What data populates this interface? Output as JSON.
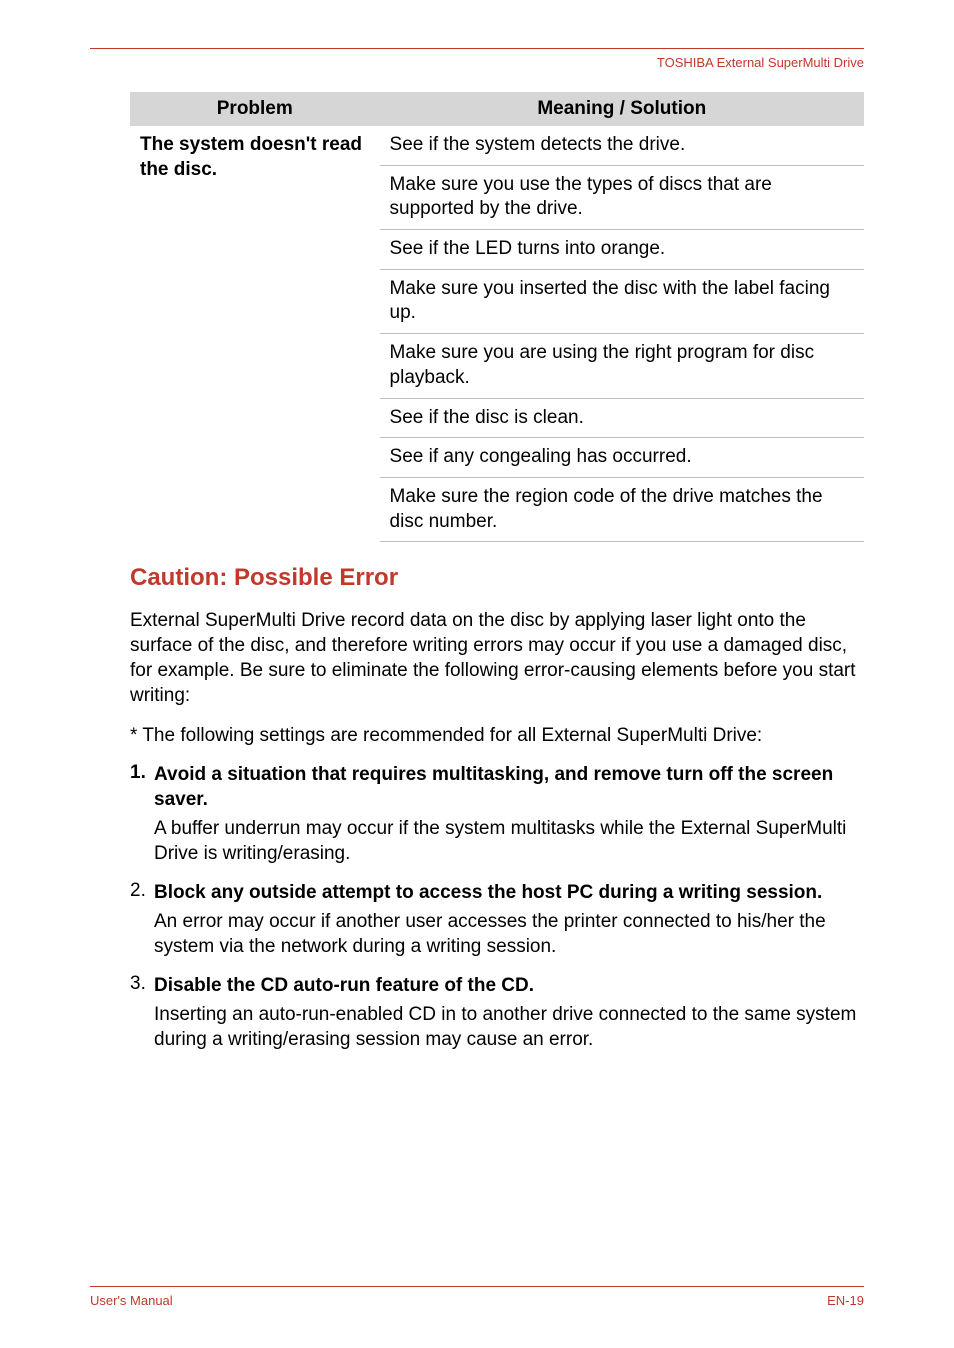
{
  "header": {
    "product": "TOSHIBA External SuperMulti Drive"
  },
  "table": {
    "headers": {
      "problem": "Problem",
      "meaning": "Meaning / Solution"
    },
    "problem": "The system doesn't read the disc.",
    "solutions": [
      "See if the system detects the drive.",
      "Make sure you use the types of discs that are supported by the drive.",
      "See if the LED turns into orange.",
      "Make sure you inserted the disc with the label facing up.",
      "Make sure you are using the right program for disc playback.",
      "See if the disc is clean.",
      "See if any congealing has occurred.",
      "Make sure the region code of the drive matches the disc number."
    ]
  },
  "section": {
    "heading": "Caution: Possible Error"
  },
  "paragraphs": {
    "p1": "External SuperMulti Drive record data on the disc by applying laser light onto the surface of the disc, and therefore writing errors may occur if you use a damaged disc, for example. Be sure to eliminate the following error-causing elements before you start writing:",
    "p2": "* The following settings are recommended for all External SuperMulti Drive:"
  },
  "list": [
    {
      "num": "1.",
      "numBold": true,
      "title": "Avoid a situation that requires multitasking, and remove turn off the screen saver.",
      "desc": "A buffer underrun may occur if the system multitasks while the External SuperMulti Drive is writing/erasing."
    },
    {
      "num": "2.",
      "numBold": false,
      "title": "Block any outside attempt to access the host PC during a writing session.",
      "desc": "An error may occur if another user accesses the printer connected to his/her the system via the network during a writing session."
    },
    {
      "num": "3.",
      "numBold": false,
      "title": "Disable the CD auto-run feature of the CD.",
      "desc": "Inserting an auto-run-enabled CD in to another drive connected to the same system during a writing/erasing session may cause an error."
    }
  ],
  "footer": {
    "left": "User's Manual",
    "right": "EN-19"
  }
}
